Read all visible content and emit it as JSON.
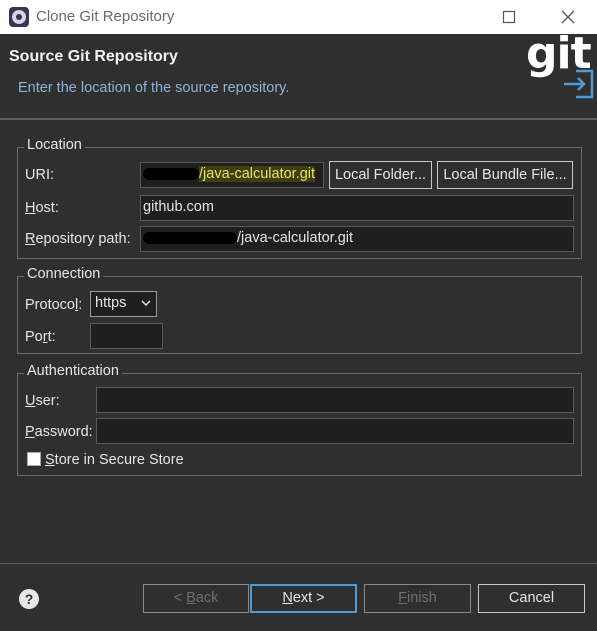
{
  "window": {
    "title": "Clone Git Repository"
  },
  "header": {
    "heading": "Source Git Repository",
    "description": "Enter the location of the source repository.",
    "logo_text": "git"
  },
  "location": {
    "legend": "Location",
    "uri_label": "URI:",
    "uri_value_visible": "/java-calculator.git",
    "host_label": "Host:",
    "host_value": "github.com",
    "repo_path_label": "Repository path:",
    "repo_path_visible": "/java-calculator.git",
    "local_folder_button": "Local Folder...",
    "local_bundle_button": "Local Bundle File..."
  },
  "connection": {
    "legend": "Connection",
    "protocol_label": "Protocol:",
    "protocol_value": "https",
    "port_label": "Port:",
    "port_value": ""
  },
  "authentication": {
    "legend": "Authentication",
    "user_label": "User:",
    "user_value": "",
    "password_label": "Password:",
    "password_value": "",
    "store_label": "Store in Secure Store",
    "store_checked": false
  },
  "footer": {
    "back_button": "< Back",
    "next_button": "Next >",
    "finish_button": "Finish",
    "cancel_button": "Cancel",
    "help_icon": "?"
  },
  "colors": {
    "background": "#2f2f2f",
    "field_background": "#1f1f1f",
    "description_text": "#8fb3d6",
    "highlight": "#e8e36a",
    "primary_border": "#4a9bd8",
    "logo_arrow": "#4a9bd8"
  }
}
